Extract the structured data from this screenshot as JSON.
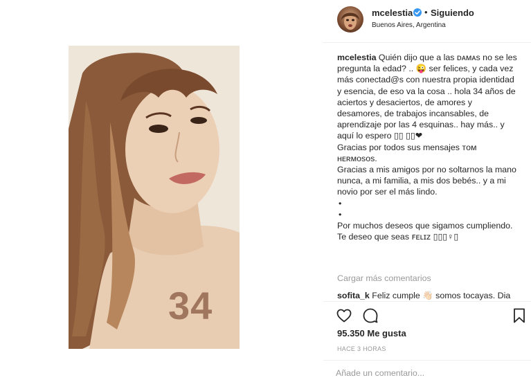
{
  "header": {
    "username": "mcelestia",
    "separator": "•",
    "follow_status": "Siguiendo",
    "location": "Buenos Aires, Argentina",
    "verified_icon": "verified-badge-icon"
  },
  "photo": {
    "overlay_number": "34"
  },
  "caption": {
    "username": "mcelestia",
    "text": " Quién dijo que a las ᴅᴀᴍᴀs no se les pregunta la edad? .. 😜 ser felices, y cada vez más conectad@s con nuestra propia identidad y esencia, de eso va la cosa .. hola 34 años de aciertos y desaciertos, de amores y desamores, de trabajos incansables, de aprendizaje por las 4 esquinas.. hay más.. y aquí lo espero ▯▯ ▯▯❤",
    "para2": "Gracias por todos sus mensajes ᴛᴏᴍ ʜᴇʀᴍᴏsᴏs.",
    "para3": "Gracias a mis amigos por no soltarnos la mano nunca, a mi familia, a mis dos bebés.. y a mi novio por ser el más lindo.",
    "bullet1": "•",
    "bullet2": "•",
    "para4": "Por muchos deseos que sigamos cumpliendo. Te deseo que seas ꜰᴇʟɪᴢ ▯▯▯♀▯"
  },
  "load_more": "Cargar más comentarios",
  "first_comment": {
    "username": "sofita_k",
    "text": " Feliz cumple 👋🏻 somos tocayas. Dia"
  },
  "actions": {
    "like_icon": "heart-icon",
    "comment_icon": "speech-bubble-icon",
    "save_icon": "bookmark-icon"
  },
  "likes": "95.350 Me gusta",
  "time": "HACE 3 HORAS",
  "add_comment": {
    "placeholder": "Añade un comentario..."
  }
}
